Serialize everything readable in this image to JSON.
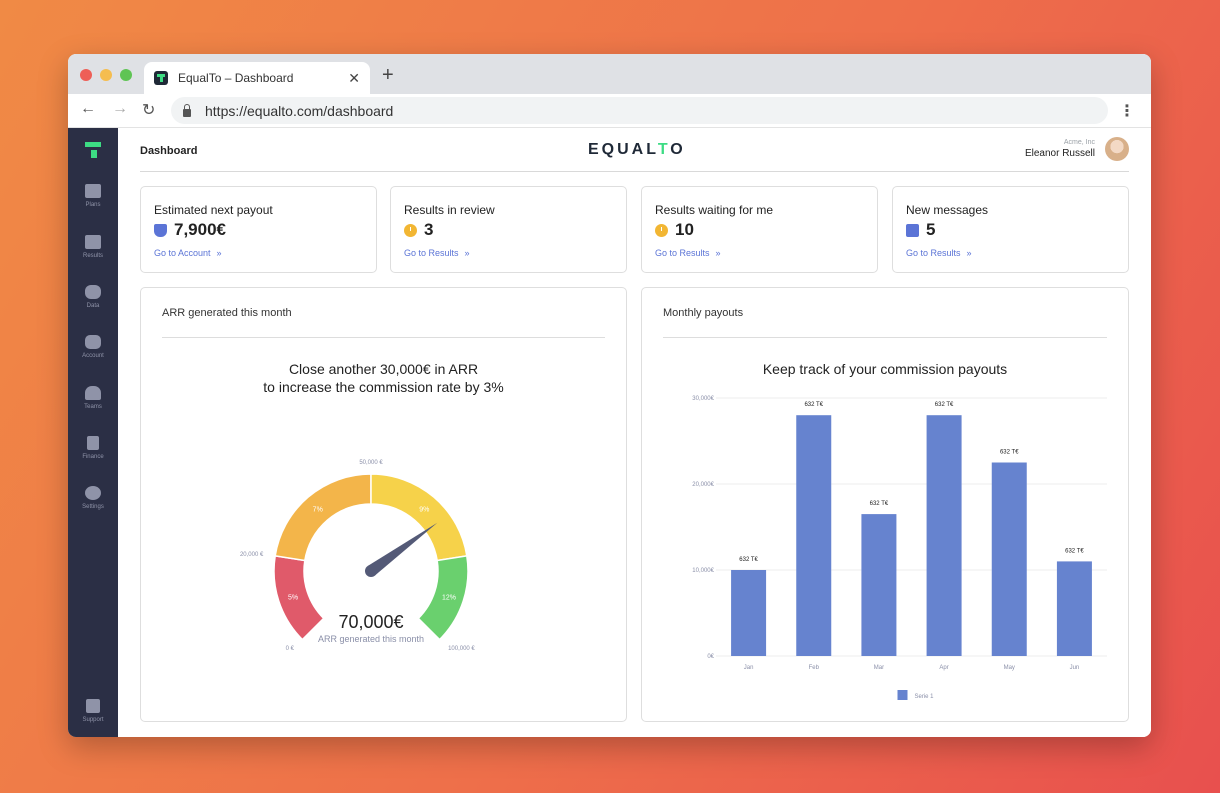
{
  "browser": {
    "tab_title": "EqualTo – Dashboard",
    "tab_close": "✕",
    "new_tab": "+",
    "url": "https://equalto.com/dashboard",
    "back": "←",
    "forward": "→",
    "reload": "↻",
    "menu": "⋮"
  },
  "sidebar": {
    "items": [
      {
        "label": "Plans",
        "icon": "grid-icon"
      },
      {
        "label": "Results",
        "icon": "table-icon"
      },
      {
        "label": "Data",
        "icon": "database-icon"
      },
      {
        "label": "Account",
        "icon": "coins-icon"
      },
      {
        "label": "Teams",
        "icon": "users-icon"
      },
      {
        "label": "Finance",
        "icon": "document-icon"
      },
      {
        "label": "Settings",
        "icon": "gears-icon"
      }
    ],
    "support": {
      "label": "Support",
      "icon": "question-icon"
    }
  },
  "header": {
    "breadcrumb": "Dashboard",
    "brand": "EQUALTO",
    "brand_parts": [
      "EQUAL",
      "T",
      "O"
    ],
    "company": "Acme, Inc",
    "user": "Eleanor Russell"
  },
  "kpis": [
    {
      "title": "Estimated next payout",
      "value": "7,900€",
      "icon": "trophy-icon",
      "link": "Go to Account"
    },
    {
      "title": "Results in review",
      "value": "3",
      "icon": "clock-icon",
      "link": "Go to Results"
    },
    {
      "title": "Results waiting for me",
      "value": "10",
      "icon": "clock-icon",
      "link": "Go to Results"
    },
    {
      "title": "New messages",
      "value": "5",
      "icon": "chat-icon",
      "link": "Go to Results"
    }
  ],
  "arr_panel": {
    "title": "ARR generated this month",
    "heading_line1": "Close another 30,000€ in ARR",
    "heading_line2": "to increase the commission rate by 3%",
    "gauge": {
      "value_label": "70,000€",
      "caption": "ARR generated this month",
      "value": 70000,
      "min": 0,
      "max": 100000,
      "segments": [
        {
          "label": "5%",
          "from": 0,
          "to": 20000,
          "color": "#e05a6a"
        },
        {
          "label": "7%",
          "from": 20000,
          "to": 50000,
          "color": "#f3b54a"
        },
        {
          "label": "9%",
          "from": 50000,
          "to": 80000,
          "color": "#f6d24a"
        },
        {
          "label": "12%",
          "from": 80000,
          "to": 100000,
          "color": "#6ad06e"
        }
      ],
      "ticks": [
        "0 €",
        "20,000 €",
        "50,000 €",
        "100,000 €"
      ]
    }
  },
  "payouts_panel": {
    "title": "Monthly payouts",
    "heading": "Keep track of your commission payouts"
  },
  "chart_data": {
    "type": "bar",
    "title": "Keep track of your commission payouts",
    "categories": [
      "Jan",
      "Feb",
      "Mar",
      "Apr",
      "May",
      "Jun"
    ],
    "series": [
      {
        "name": "Serie 1",
        "values": [
          10000,
          28000,
          16500,
          28000,
          22500,
          11000
        ],
        "color": "#6683cf"
      }
    ],
    "data_labels": [
      "632 T€",
      "632 T€",
      "632 T€",
      "632 T€",
      "632 T€",
      "632 T€"
    ],
    "yticks": [
      "0€",
      "10,000€",
      "20,000€",
      "30,000€"
    ],
    "ylim": [
      0,
      30000
    ],
    "grid": true,
    "legend": "bottom"
  }
}
